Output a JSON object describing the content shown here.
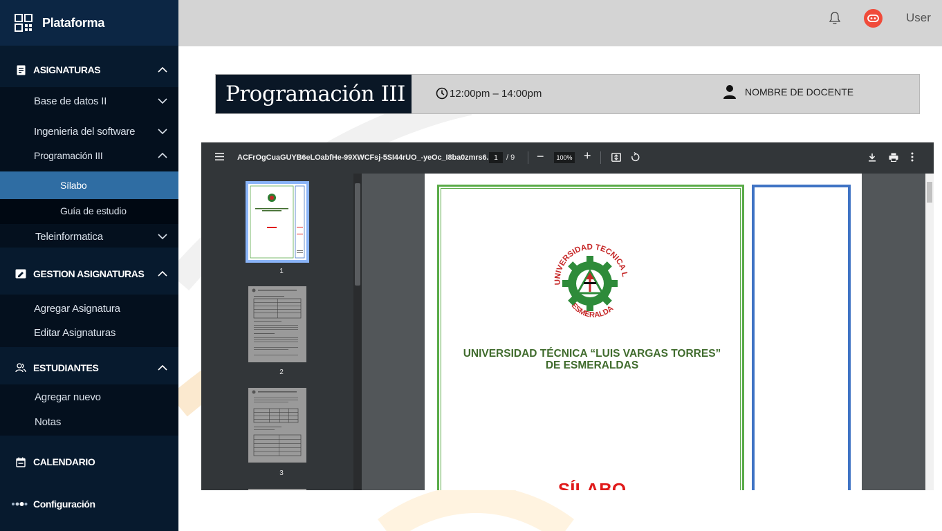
{
  "sidebar": {
    "brand": "Plataforma",
    "sections": {
      "asignaturas": "ASIGNATURAS",
      "gestion": "GESTION ASIGNATURAS",
      "estudiantes": "ESTUDIANTES",
      "calendario": "CALENDARIO",
      "configuracion": "Configuración"
    },
    "asignaturas_items": [
      "Base de datos II",
      "Ingenieria del software",
      "Programación III",
      "Teleinformatica"
    ],
    "programacion_sub": [
      "Sílabo",
      "Guía de estudio"
    ],
    "gestion_items": [
      "Agregar Asignatura",
      "Editar Asignaturas"
    ],
    "estudiantes_items": [
      "Agregar nuevo",
      "Notas"
    ]
  },
  "topbar": {
    "user": "User"
  },
  "course": {
    "title": "Programación III",
    "time": "12:00pm – 14:00pm",
    "teacher": "NOMBRE DE DOCENTE"
  },
  "viewer": {
    "filename": "ACFrOgCuaGUYB6eLOabfHe-99XWCFsj-5SI44rUO_-yeOc_I8ba0zmrs6...",
    "page": "1",
    "page_total": "/ 9",
    "zoom": "100%",
    "thumbnails": [
      "1",
      "2",
      "3"
    ],
    "doc": {
      "university_line1": "UNIVERSIDAD TÉCNICA “LUIS VARGAS TORRES”",
      "university_line2": "DE ESMERALDAS",
      "heading": "SÍLABO",
      "seal_top": "UNIVERSIDAD TECNICA LUIS VARGAS TORRES",
      "seal_bottom": "ESMERALDAS"
    }
  },
  "colors": {
    "sidebar": "#071a2e",
    "brand_bar": "#0c2644",
    "active_item": "#2f6da3",
    "topbar": "#d4d4d4",
    "avatar": "#f04b3a",
    "doc_green": "#3f6b2c",
    "doc_red": "#e01b1b",
    "doc_blue_frame": "#3f73c4"
  }
}
